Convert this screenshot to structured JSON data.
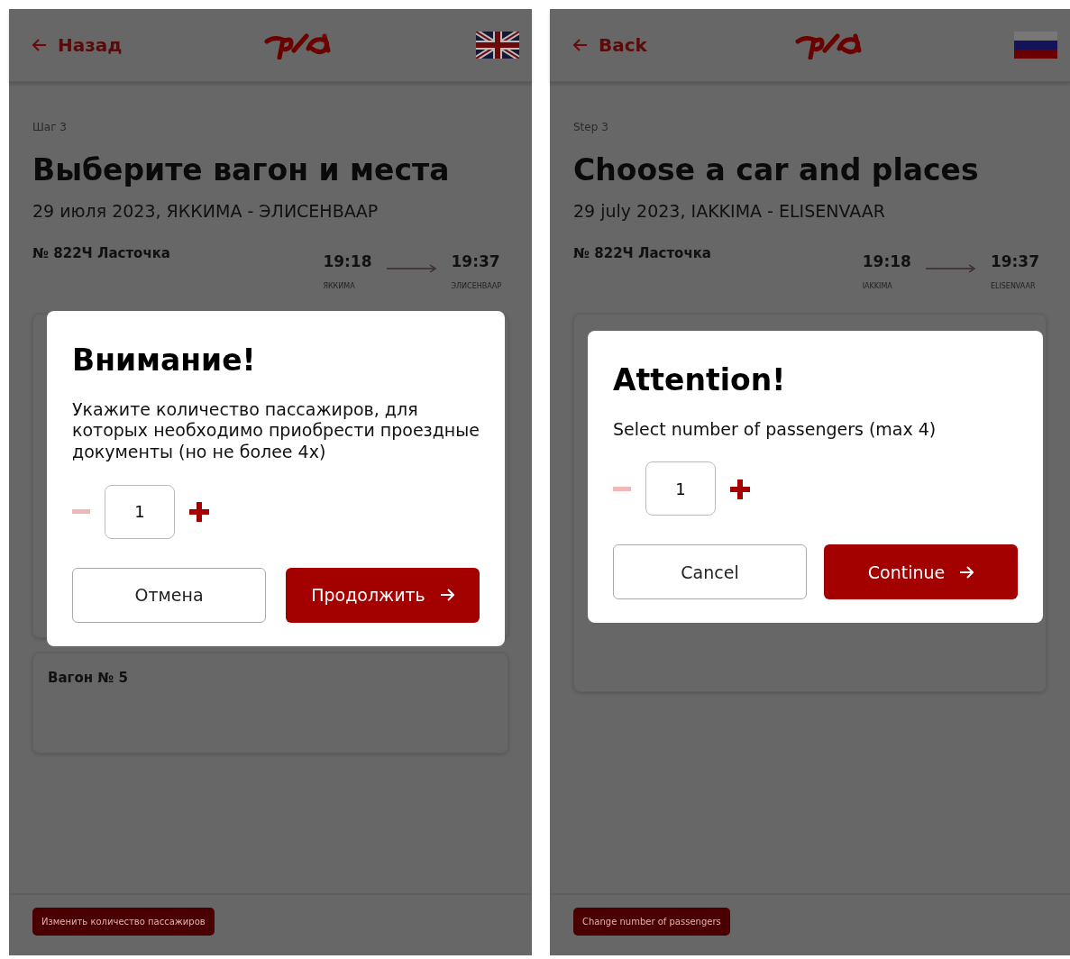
{
  "screens": [
    {
      "header": {
        "back": "Назад",
        "flag": {
          "kind": "uk"
        }
      },
      "step": "Шаг 3",
      "title": "Выберите вагон и места",
      "subtitle": "29 июля 2023, ЯККИМА - ЭЛИСЕНВААР",
      "train": {
        "name": "№ 822Ч Ласточка",
        "departure_time": "19:18",
        "arrival_time": "19:37",
        "departure_station": "ЯККИМА",
        "arrival_station": "ЭЛИСЕНВААР"
      },
      "cars": [
        {
          "title": "Вагон № 5"
        }
      ],
      "modal": {
        "title": "Внимание!",
        "text": "Укажите количество пассажиров, для которых необходимо приобрести проездные документы (но не более 4х)",
        "count": "1",
        "minus_disabled": true,
        "cancel": "Отмена",
        "continue": "Продолжить"
      },
      "bottom_button": "Изменить количество пассажиров"
    },
    {
      "header": {
        "back": "Back",
        "flag": {
          "kind": "ru"
        }
      },
      "step": "Step 3",
      "title": "Choose a car and places",
      "subtitle": "29 july 2023, IAKKIMA - ELISENVAAR",
      "train": {
        "name": "№ 822Ч Ласточка",
        "departure_time": "19:18",
        "arrival_time": "19:37",
        "departure_station": "IAKKIMA",
        "arrival_station": "ELISENVAAR"
      },
      "modal": {
        "title": "Attention!",
        "text": "Select number of passengers (max 4)",
        "count": "1",
        "minus_disabled": true,
        "cancel": "Cancel",
        "continue": "Continue"
      },
      "bottom_button": "Change number of passengers"
    }
  ]
}
